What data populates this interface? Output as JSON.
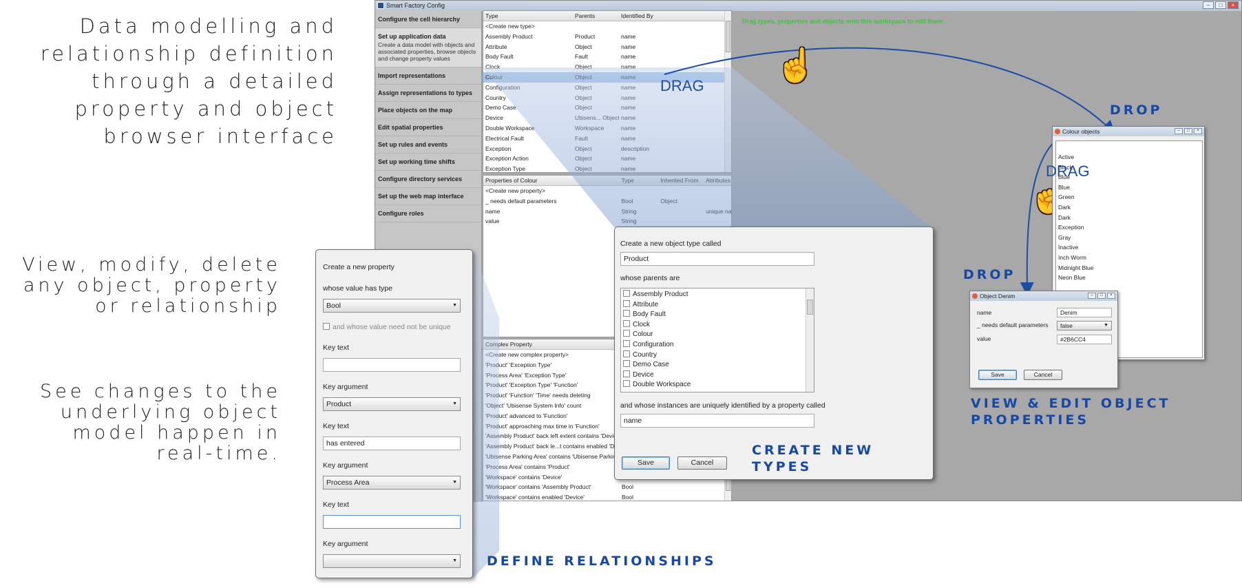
{
  "captions": {
    "top": [
      "Data modelling and",
      "relationship definition",
      "through a detailed",
      "property and object",
      "browser interface"
    ],
    "middle": [
      "View, modify, delete",
      "any object, property",
      "or relationship"
    ],
    "bottom": [
      "See changes to the",
      "underlying object",
      "model happen in",
      "real-time."
    ]
  },
  "app": {
    "title": "Smart Factory Config",
    "win_buttons": [
      "–",
      "□",
      "×"
    ],
    "workspace_hint": "Drag types, properties and objects onto this workspace to edit them.",
    "sidebar": [
      {
        "label": "Configure the cell hierarchy",
        "desc": ""
      },
      {
        "label": "Set up application data",
        "desc": "Create a data model with objects and associated properties, browse objects and change property values"
      },
      {
        "label": "Import representations",
        "desc": ""
      },
      {
        "label": "Assign representations to types",
        "desc": ""
      },
      {
        "label": "Place objects on the map",
        "desc": ""
      },
      {
        "label": "Edit spatial properties",
        "desc": ""
      },
      {
        "label": "Set up rules and events",
        "desc": ""
      },
      {
        "label": "Set up working time shifts",
        "desc": ""
      },
      {
        "label": "Configure directory services",
        "desc": ""
      },
      {
        "label": "Set up the web map interface",
        "desc": ""
      },
      {
        "label": "Configure roles",
        "desc": ""
      }
    ],
    "types_table": {
      "headers": [
        "Type",
        "Parents",
        "Identified By"
      ],
      "rows": [
        [
          "<Create new type>",
          "",
          ""
        ],
        [
          "Assembly Product",
          "Product",
          "name"
        ],
        [
          "Attribute",
          "Object",
          "name"
        ],
        [
          "Body Fault",
          "Fault",
          "name"
        ],
        [
          "Clock",
          "Object",
          "name"
        ],
        [
          "Colour",
          "Object",
          "name"
        ],
        [
          "Configuration",
          "Object",
          "name"
        ],
        [
          "Country",
          "Object",
          "name"
        ],
        [
          "Demo Case",
          "Object",
          "name"
        ],
        [
          "Device",
          "Ubisens... Object",
          "name"
        ],
        [
          "Double Workspace",
          "Workspace",
          "name"
        ],
        [
          "Electrical Fault",
          "Fault",
          "name"
        ],
        [
          "Exception",
          "Object",
          "description"
        ],
        [
          "Exception Action",
          "Object",
          "name"
        ],
        [
          "Exception Type",
          "Object",
          "name"
        ]
      ],
      "selected_index": 5
    },
    "props_table": {
      "headers": [
        "Properties of Colour",
        "Type",
        "Inherited From",
        "Attributes"
      ],
      "rows": [
        [
          "<Create new property>",
          "",
          "",
          ""
        ],
        [
          "_ needs default parameters",
          "Bool",
          "Object",
          ""
        ],
        [
          "name",
          "String",
          "",
          "unique name"
        ],
        [
          "value",
          "String",
          "",
          ""
        ]
      ]
    },
    "complex_table": {
      "headers": [
        "Complex Property"
      ],
      "rows": [
        [
          "<Create new complex property>",
          ""
        ],
        [
          "'Product' 'Exception Type'",
          ""
        ],
        [
          "'Process Area' 'Exception Type'",
          ""
        ],
        [
          "'Product' 'Exception Type' 'Function'",
          ""
        ],
        [
          "'Product' 'Function' 'Time' needs deleting",
          ""
        ],
        [
          "'Object' 'Ubisense System Info' count",
          ""
        ],
        [
          "'Product' advanced to 'Function'",
          ""
        ],
        [
          "'Product' approaching max time in 'Function'",
          ""
        ],
        [
          "'Assembly Product' back left extent contains 'Device'",
          ""
        ],
        [
          "'Assembly Product' back le...t contains enabled 'Devic",
          ""
        ],
        [
          "'Ubisense Parking Area' contains 'Ubisense Parking Ba",
          ""
        ],
        [
          "'Process Area' contains 'Product'",
          ""
        ],
        [
          "'Workspace' contains 'Device'",
          ""
        ],
        [
          "'Workspace' contains 'Assembly Product'",
          "Bool"
        ],
        [
          "'Workspace' contains enabled 'Device'",
          "Bool"
        ]
      ]
    }
  },
  "property_dialog": {
    "title_line": "Create a new property",
    "value_type_label": "whose value has type",
    "value_type": "Bool",
    "unique_label": "and whose value need not be unique",
    "key_text_label": "Key text",
    "key_argument_label": "Key argument",
    "key_text_1": "",
    "key_argument_1": "Product",
    "key_text_2": "has entered",
    "key_argument_2": "Process Area",
    "key_text_3": "",
    "key_argument_3": ""
  },
  "type_dialog": {
    "name_label": "Create a new object type called",
    "name_value": "Product",
    "parents_label": "whose parents are",
    "parents": [
      "Assembly Product",
      "Attribute",
      "Body Fault",
      "Clock",
      "Colour",
      "Configuration",
      "Country",
      "Demo Case",
      "Device",
      "Double Workspace"
    ],
    "id_label": "and whose instances are uniquely identified by a property called",
    "id_value": "name",
    "save": "Save",
    "cancel": "Cancel"
  },
  "colour_window": {
    "title": "Colour objects",
    "items": [
      "Active",
      "Black",
      "Blue",
      "Blue",
      "Green",
      "Dark",
      "Dark",
      "Exception",
      "Gray",
      "Inactive",
      "Inch Worm",
      "Midnight Blue",
      "Neon Blue"
    ]
  },
  "denim_window": {
    "title": "Object Denim",
    "fields": [
      {
        "label": "name",
        "value": "Denim"
      },
      {
        "label": "_ needs default parameters",
        "value": "false"
      },
      {
        "label": "value",
        "value": "#2B6CC4"
      }
    ],
    "save": "Save",
    "cancel": "Cancel"
  },
  "annotations": {
    "drag1": "DRAG",
    "drag2": "DRAG",
    "drop1": "DROP",
    "drop2": "DROP",
    "view_edit_1": "VIEW & EDIT OBJECT",
    "view_edit_2": "PROPERTIES",
    "create_1": "CREATE NEW",
    "create_2": "TYPES",
    "define": "DEFINE RELATIONSHIPS"
  }
}
